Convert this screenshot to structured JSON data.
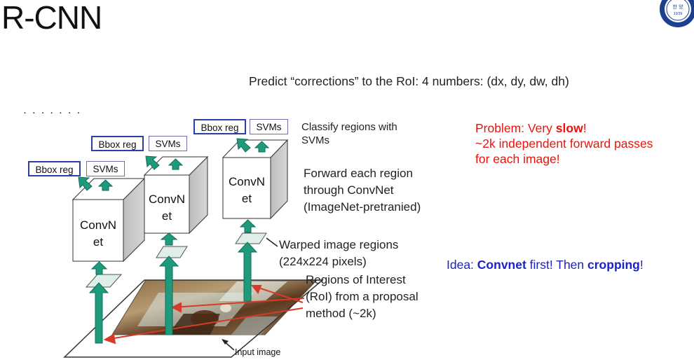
{
  "slide": {
    "title": "R-CNN",
    "predict_note": "Predict “corrections” to the RoI: 4 numbers: (dx, dy, dw, dh)"
  },
  "diagram": {
    "stages": [
      {
        "bbox_label": "Bbox reg",
        "svm_label": "SVMs",
        "convnet_line1": "ConvN",
        "convnet_line2": "et"
      },
      {
        "bbox_label": "Bbox reg",
        "svm_label": "SVMs",
        "convnet_line1": "ConvN",
        "convnet_line2": "et"
      },
      {
        "bbox_label": "Bbox reg",
        "svm_label": "SVMs",
        "convnet_line1": "ConvN",
        "convnet_line2": "et"
      }
    ],
    "annotations": {
      "classify": [
        "Classify regions with",
        "SVMs"
      ],
      "forward": [
        "Forward each region",
        "through ConvNet",
        "(ImageNet-pretranied)"
      ],
      "warped": [
        "Warped image regions",
        "(224x224 pixels)"
      ],
      "roi": [
        "Regions of Interest",
        "(RoI) from a proposal",
        "method (~2k)"
      ],
      "input": "Input image"
    },
    "colors": {
      "arrow": "#1f9a7c",
      "arrow_edge": "#0f6e58",
      "red_arrow": "#d63a2a",
      "bbox_border": "#2c3fa6",
      "svm_border": "#7a6bb0"
    }
  },
  "problem": {
    "line1_pre": "Problem: Very ",
    "line1_bold": "slow",
    "line1_post": "!",
    "line2": "~2k independent forward passes",
    "line3": "for each image!"
  },
  "idea": {
    "pre": "Idea: ",
    "bold1": "Convnet",
    "mid": " first! Then ",
    "bold2": "cropping",
    "post": "!"
  },
  "logo": {
    "icon": "university-seal-icon",
    "text_top": "한 양",
    "text_year": "1939"
  }
}
